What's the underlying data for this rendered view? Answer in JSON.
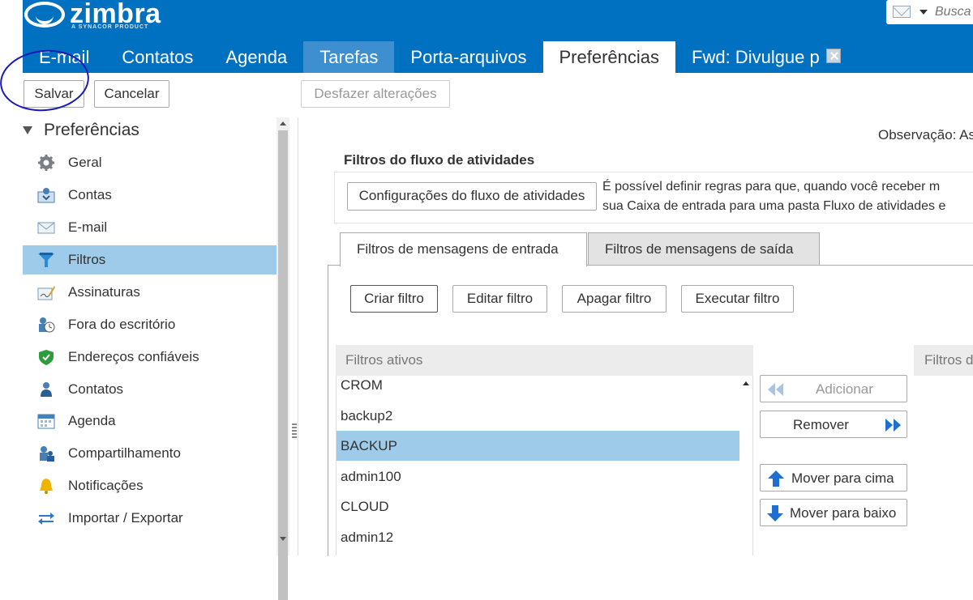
{
  "header": {
    "logo_text": "zimbra",
    "logo_subtext": "A SYNACOR PRODUCT",
    "search_placeholder": "Busca",
    "brand_color": "#0071c1",
    "tabs": [
      {
        "label": "E-mail"
      },
      {
        "label": "Contatos"
      },
      {
        "label": "Agenda"
      },
      {
        "label": "Tarefas"
      },
      {
        "label": "Porta-arquivos"
      },
      {
        "label": "Preferências"
      },
      {
        "label": "Fwd: Divulgue p"
      }
    ]
  },
  "toolbar": {
    "save_label": "Salvar",
    "cancel_label": "Cancelar",
    "undo_label": "Desfazer alterações"
  },
  "sidebar": {
    "root_label": "Preferências",
    "items": [
      {
        "label": "Geral",
        "icon": "gear-icon"
      },
      {
        "label": "Contas",
        "icon": "accounts-icon"
      },
      {
        "label": "E-mail",
        "icon": "mail-icon"
      },
      {
        "label": "Filtros",
        "icon": "filter-icon"
      },
      {
        "label": "Assinaturas",
        "icon": "signature-icon"
      },
      {
        "label": "Fora do escritório",
        "icon": "out-of-office-icon"
      },
      {
        "label": "Endereços confiáveis",
        "icon": "shield-icon"
      },
      {
        "label": "Contatos",
        "icon": "contact-icon"
      },
      {
        "label": "Agenda",
        "icon": "calendar-icon"
      },
      {
        "label": "Compartilhamento",
        "icon": "sharing-icon"
      },
      {
        "label": "Notificações",
        "icon": "bell-icon"
      },
      {
        "label": "Importar / Exportar",
        "icon": "import-export-icon"
      }
    ]
  },
  "main": {
    "observation": "Observação: As",
    "activity_title": "Filtros do fluxo de atividades",
    "activity_button": "Configurações do fluxo de atividades",
    "activity_desc_line1": "É possível definir regras para que, quando você receber m",
    "activity_desc_line2": "sua Caixa de entrada para uma pasta Fluxo de atividades e",
    "subtabs": {
      "incoming": "Filtros de mensagens de entrada",
      "outgoing": "Filtros de mensagens de saída"
    },
    "actions": {
      "create": "Criar filtro",
      "edit": "Editar filtro",
      "delete": "Apagar filtro",
      "run": "Executar filtro"
    },
    "active_filters_header": "Filtros ativos",
    "available_filters_header": "Filtros d",
    "active_filters": [
      "CROM",
      "backup2",
      "BACKUP",
      "admin100",
      "CLOUD",
      "admin12"
    ],
    "side_buttons": {
      "add": "Adicionar",
      "remove": "Remover",
      "move_up": "Mover para cima",
      "move_down": "Mover para baixo"
    }
  }
}
